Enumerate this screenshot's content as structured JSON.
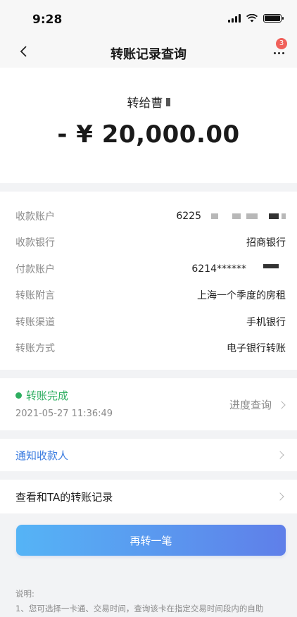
{
  "status_bar": {
    "time": "9:28"
  },
  "nav": {
    "title": "转账记录查询",
    "badge": "3"
  },
  "transfer": {
    "recipient_prefix": "转给曹",
    "amount": "- ¥ 20,000.00"
  },
  "details": [
    {
      "label": "收款账户",
      "value": "6225"
    },
    {
      "label": "收款银行",
      "value": "招商银行"
    },
    {
      "label": "付款账户",
      "value": "6214******"
    },
    {
      "label": "转账附言",
      "value": "上海一个季度的房租"
    },
    {
      "label": "转账渠道",
      "value": "手机银行"
    },
    {
      "label": "转账方式",
      "value": "电子银行转账"
    }
  ],
  "status": {
    "label": "转账完成",
    "timestamp": "2021-05-27 11:36:49",
    "progress_link": "进度查询"
  },
  "actions": {
    "notify": "通知收款人",
    "history": "查看和TA的转账记录",
    "transfer_again": "再转一笔"
  },
  "notes": {
    "title": "说明:",
    "line1": "1、您可选择一卡通、交易时间，查询该卡在指定交易时间段内的自助"
  },
  "colors": {
    "success": "#2eae60",
    "link": "#3b7ce0",
    "badge": "#f0605a"
  }
}
